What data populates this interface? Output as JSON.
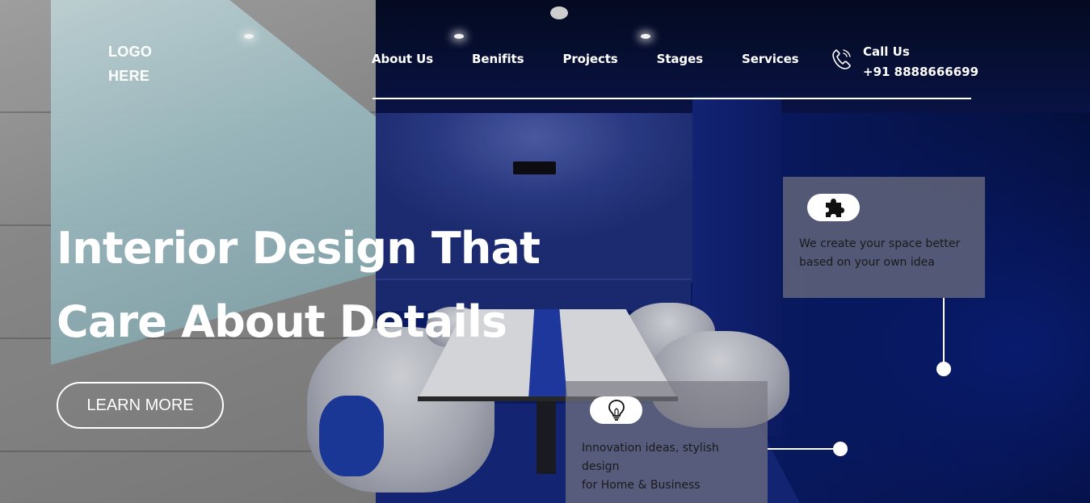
{
  "header": {
    "logo_line1": "LOGO",
    "logo_line2": "HERE",
    "nav": [
      {
        "label": "About Us"
      },
      {
        "label": "Benifits"
      },
      {
        "label": "Projects"
      },
      {
        "label": "Stages"
      },
      {
        "label": "Services"
      }
    ],
    "call": {
      "icon": "phone-icon",
      "label": "Call Us",
      "number": "+91 8888666699"
    }
  },
  "hero": {
    "title_line1": "Interior Design That",
    "title_line2": "Care About Details",
    "cta_label": "LEARN MORE"
  },
  "features": [
    {
      "icon": "puzzle-icon",
      "text": "We create your space better based on your own idea"
    },
    {
      "icon": "lightbulb-icon",
      "text_line1": "Innovation ideas, stylish design",
      "text_line2": "for Home & Business"
    }
  ],
  "colors": {
    "text": "#ffffff",
    "card_background": "rgba(120,120,130,0.68)",
    "card_text": "#1a1a1a",
    "room_blue": "#0b1d6a"
  }
}
